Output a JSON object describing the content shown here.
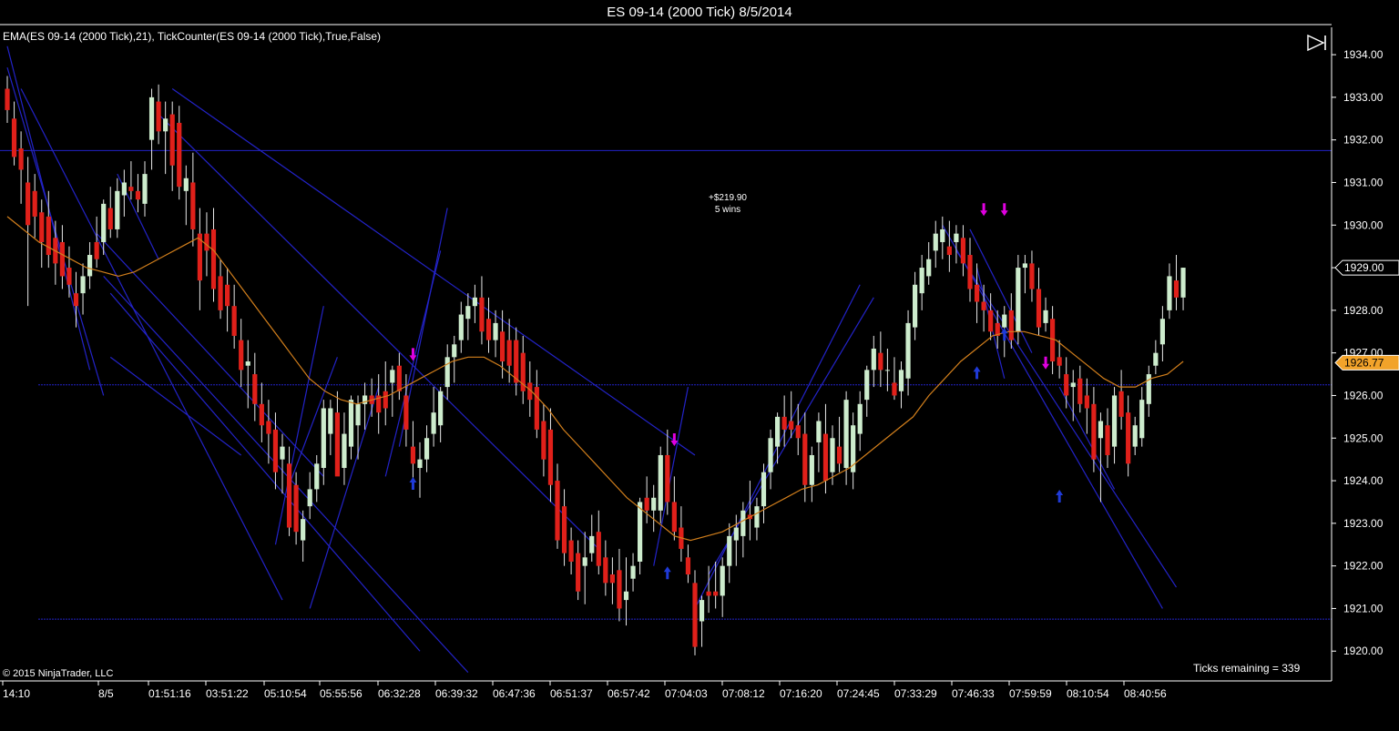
{
  "window": {
    "title": "ES 09-14 (2000 Tick)  8/5/2014"
  },
  "indicators_label": "EMA(ES 09-14 (2000 Tick),21),  TickCounter(ES 09-14 (2000 Tick),True,False)",
  "copyright": "© 2015 NinjaTrader, LLC",
  "ticks_remaining": "Ticks remaining = 339",
  "pnl": {
    "amount": "+$219.90",
    "wins": "5 wins"
  },
  "colors": {
    "background": "#000000",
    "up_candle": "#cdeccd",
    "down_candle": "#e0201a",
    "ema": "#d27f1c",
    "trendline": "#2323c8",
    "buy_arrow": "#1f3ad8",
    "sell_arrow": "#e000e0",
    "axis": "#ffffff",
    "last_price_fill": "#000000",
    "ema_price_fill": "#f2a32a"
  },
  "chart_data": {
    "type": "candlestick",
    "instrument": "ES 09-14",
    "bar_type": "2000 Tick",
    "ylim": [
      1919.3,
      1934.6
    ],
    "y_ticks": [
      "1934.00",
      "1933.00",
      "1932.00",
      "1931.00",
      "1930.00",
      "1929.00",
      "1928.00",
      "1927.00",
      "1926.00",
      "1925.00",
      "1924.00",
      "1923.00",
      "1922.00",
      "1921.00",
      "1920.00"
    ],
    "x_ticks": [
      "14:10",
      "8/5",
      "01:51:16",
      "03:51:22",
      "05:10:54",
      "05:55:56",
      "06:32:28",
      "06:39:32",
      "06:47:36",
      "06:51:37",
      "06:57:42",
      "07:04:03",
      "07:08:12",
      "07:16:20",
      "07:24:45",
      "07:33:29",
      "07:46:33",
      "07:59:59",
      "08:10:54",
      "08:40:56"
    ],
    "last_price_label": "1929.00",
    "ema_price_label": "1926.77",
    "horizontal_lines": [
      1931.75,
      1926.25,
      1920.75
    ],
    "candles": [
      [
        1933.2,
        1933.5,
        1932.4,
        1932.7
      ],
      [
        1932.5,
        1932.9,
        1931.4,
        1931.6
      ],
      [
        1931.8,
        1932.2,
        1930.5,
        1931.3
      ],
      [
        1931.0,
        1931.6,
        1928.1,
        1930.0
      ],
      [
        1930.8,
        1931.2,
        1929.7,
        1930.2
      ],
      [
        1930.3,
        1930.6,
        1929.0,
        1929.6
      ],
      [
        1930.2,
        1930.8,
        1929.0,
        1929.3
      ],
      [
        1929.7,
        1930.1,
        1928.6,
        1929.1
      ],
      [
        1929.6,
        1930.0,
        1928.5,
        1928.8
      ],
      [
        1929.0,
        1929.5,
        1928.3,
        1928.6
      ],
      [
        1928.4,
        1928.9,
        1927.6,
        1928.1
      ],
      [
        1928.4,
        1929.1,
        1927.9,
        1928.8
      ],
      [
        1928.8,
        1929.6,
        1928.5,
        1929.3
      ],
      [
        1929.6,
        1930.2,
        1929.0,
        1929.2
      ],
      [
        1929.6,
        1930.6,
        1929.3,
        1930.5
      ],
      [
        1930.4,
        1930.9,
        1929.7,
        1929.9
      ],
      [
        1929.9,
        1931.1,
        1929.7,
        1930.8
      ],
      [
        1930.7,
        1931.3,
        1930.2,
        1931.0
      ],
      [
        1930.9,
        1931.5,
        1930.6,
        1930.8
      ],
      [
        1930.8,
        1931.2,
        1930.3,
        1930.6
      ],
      [
        1930.5,
        1931.5,
        1930.2,
        1931.2
      ],
      [
        1932.0,
        1933.2,
        1931.3,
        1933.0
      ],
      [
        1932.9,
        1933.3,
        1931.9,
        1932.2
      ],
      [
        1932.2,
        1932.9,
        1931.2,
        1932.5
      ],
      [
        1932.6,
        1932.9,
        1930.8,
        1931.4
      ],
      [
        1932.4,
        1932.8,
        1930.6,
        1930.9
      ],
      [
        1930.8,
        1931.4,
        1930.0,
        1931.1
      ],
      [
        1931.0,
        1931.7,
        1929.5,
        1929.9
      ],
      [
        1929.8,
        1930.4,
        1928.0,
        1928.7
      ],
      [
        1929.8,
        1930.3,
        1928.8,
        1929.4
      ],
      [
        1929.9,
        1930.4,
        1928.2,
        1928.5
      ],
      [
        1928.8,
        1929.2,
        1927.8,
        1928.0
      ],
      [
        1928.6,
        1929.0,
        1927.5,
        1928.1
      ],
      [
        1928.1,
        1928.6,
        1927.1,
        1927.4
      ],
      [
        1927.3,
        1927.8,
        1926.2,
        1926.6
      ],
      [
        1926.7,
        1927.3,
        1925.7,
        1926.8
      ],
      [
        1926.5,
        1927.0,
        1925.4,
        1925.8
      ],
      [
        1925.8,
        1926.3,
        1924.9,
        1925.3
      ],
      [
        1925.4,
        1925.9,
        1924.4,
        1925.1
      ],
      [
        1925.2,
        1925.6,
        1923.8,
        1924.2
      ],
      [
        1924.5,
        1925.1,
        1923.7,
        1924.8
      ],
      [
        1924.4,
        1924.8,
        1922.7,
        1922.9
      ],
      [
        1923.9,
        1924.2,
        1922.5,
        1922.8
      ],
      [
        1922.6,
        1923.3,
        1922.1,
        1923.1
      ],
      [
        1923.4,
        1924.2,
        1923.1,
        1923.8
      ],
      [
        1923.8,
        1924.6,
        1923.5,
        1924.4
      ],
      [
        1924.3,
        1925.9,
        1923.9,
        1925.7
      ],
      [
        1925.1,
        1925.9,
        1924.6,
        1925.7
      ],
      [
        1925.6,
        1926.1,
        1924.7,
        1924.1
      ],
      [
        1924.3,
        1925.6,
        1923.9,
        1925.1
      ],
      [
        1924.8,
        1926.0,
        1924.5,
        1925.9
      ],
      [
        1925.3,
        1926.0,
        1924.5,
        1925.8
      ],
      [
        1925.8,
        1926.3,
        1925.2,
        1926.0
      ],
      [
        1926.0,
        1926.4,
        1925.5,
        1925.8
      ],
      [
        1926.0,
        1926.5,
        1925.1,
        1925.6
      ],
      [
        1926.1,
        1926.8,
        1925.3,
        1925.7
      ],
      [
        1926.3,
        1926.7,
        1925.5,
        1926.6
      ],
      [
        1926.7,
        1927.0,
        1925.9,
        1926.1
      ],
      [
        1926.0,
        1926.5,
        1924.8,
        1925.2
      ],
      [
        1924.8,
        1925.4,
        1924.0,
        1924.4
      ],
      [
        1924.3,
        1924.9,
        1923.6,
        1924.5
      ],
      [
        1924.5,
        1925.3,
        1924.2,
        1925.0
      ],
      [
        1925.1,
        1926.2,
        1924.8,
        1925.6
      ],
      [
        1925.3,
        1926.2,
        1924.9,
        1926.1
      ],
      [
        1926.2,
        1927.2,
        1925.9,
        1926.9
      ],
      [
        1926.9,
        1927.4,
        1926.3,
        1927.2
      ],
      [
        1927.3,
        1928.2,
        1927.0,
        1927.9
      ],
      [
        1927.8,
        1928.4,
        1927.3,
        1928.1
      ],
      [
        1928.1,
        1928.6,
        1927.7,
        1928.3
      ],
      [
        1928.3,
        1928.8,
        1927.2,
        1927.5
      ],
      [
        1927.8,
        1928.3,
        1927.0,
        1927.3
      ],
      [
        1927.3,
        1928.0,
        1926.9,
        1927.7
      ],
      [
        1927.5,
        1928.0,
        1926.4,
        1926.8
      ],
      [
        1927.3,
        1927.8,
        1926.3,
        1926.7
      ],
      [
        1927.3,
        1927.6,
        1926.0,
        1926.3
      ],
      [
        1927.0,
        1927.4,
        1925.8,
        1926.1
      ],
      [
        1926.3,
        1926.8,
        1925.5,
        1925.9
      ],
      [
        1926.2,
        1926.6,
        1925.0,
        1925.2
      ],
      [
        1925.4,
        1925.8,
        1924.1,
        1924.5
      ],
      [
        1925.2,
        1925.7,
        1923.5,
        1923.9
      ],
      [
        1924.0,
        1924.4,
        1922.4,
        1922.6
      ],
      [
        1923.4,
        1923.8,
        1922.0,
        1922.3
      ],
      [
        1922.6,
        1922.9,
        1921.8,
        1922.1
      ],
      [
        1922.3,
        1922.6,
        1921.2,
        1921.4
      ],
      [
        1922.0,
        1922.8,
        1921.1,
        1922.2
      ],
      [
        1922.3,
        1923.2,
        1922.1,
        1922.7
      ],
      [
        1922.8,
        1923.3,
        1921.8,
        1922.0
      ],
      [
        1922.2,
        1922.6,
        1921.3,
        1921.6
      ],
      [
        1921.8,
        1922.2,
        1921.1,
        1921.6
      ],
      [
        1921.9,
        1922.4,
        1920.7,
        1921.0
      ],
      [
        1921.2,
        1922.2,
        1920.6,
        1921.4
      ],
      [
        1921.7,
        1922.3,
        1921.4,
        1922.0
      ],
      [
        1922.1,
        1923.6,
        1921.8,
        1923.5
      ],
      [
        1923.6,
        1924.1,
        1923.0,
        1923.3
      ],
      [
        1923.3,
        1923.9,
        1922.8,
        1923.6
      ],
      [
        1923.3,
        1924.8,
        1923.0,
        1924.6
      ],
      [
        1924.6,
        1925.2,
        1923.2,
        1923.5
      ],
      [
        1923.5,
        1924.1,
        1922.6,
        1922.8
      ],
      [
        1922.9,
        1923.4,
        1922.1,
        1922.4
      ],
      [
        1922.2,
        1922.5,
        1921.6,
        1921.8
      ],
      [
        1921.6,
        1921.9,
        1919.9,
        1920.1
      ],
      [
        1920.7,
        1921.3,
        1920.1,
        1921.2
      ],
      [
        1921.4,
        1922.0,
        1920.9,
        1921.3
      ],
      [
        1921.4,
        1922.1,
        1921.0,
        1921.3
      ],
      [
        1921.3,
        1922.2,
        1920.8,
        1922.0
      ],
      [
        1922.0,
        1923.0,
        1921.6,
        1922.7
      ],
      [
        1922.6,
        1923.2,
        1922.0,
        1922.9
      ],
      [
        1922.7,
        1923.5,
        1922.2,
        1923.3
      ],
      [
        1923.2,
        1924.0,
        1922.6,
        1923.1
      ],
      [
        1922.9,
        1923.6,
        1922.6,
        1923.4
      ],
      [
        1923.4,
        1924.4,
        1923.0,
        1924.2
      ],
      [
        1924.2,
        1925.2,
        1923.8,
        1925.0
      ],
      [
        1924.8,
        1925.6,
        1924.4,
        1925.5
      ],
      [
        1925.5,
        1926.0,
        1924.8,
        1925.2
      ],
      [
        1925.4,
        1926.1,
        1925.0,
        1925.2
      ],
      [
        1925.3,
        1925.8,
        1924.6,
        1925.0
      ],
      [
        1925.1,
        1925.6,
        1923.5,
        1923.9
      ],
      [
        1923.9,
        1924.8,
        1923.5,
        1924.6
      ],
      [
        1924.9,
        1925.6,
        1924.2,
        1925.4
      ],
      [
        1925.1,
        1925.8,
        1923.7,
        1924.0
      ],
      [
        1924.2,
        1925.3,
        1923.9,
        1925.0
      ],
      [
        1924.8,
        1925.5,
        1924.2,
        1924.4
      ],
      [
        1924.3,
        1926.1,
        1923.9,
        1925.9
      ],
      [
        1924.2,
        1925.6,
        1923.8,
        1925.3
      ],
      [
        1925.1,
        1926.1,
        1924.7,
        1925.8
      ],
      [
        1925.9,
        1926.7,
        1925.5,
        1926.6
      ],
      [
        1926.6,
        1927.4,
        1926.2,
        1927.1
      ],
      [
        1927.0,
        1927.5,
        1926.2,
        1926.6
      ],
      [
        1926.6,
        1927.1,
        1926.1,
        1926.6
      ],
      [
        1926.3,
        1926.9,
        1925.9,
        1926.0
      ],
      [
        1926.1,
        1926.8,
        1925.7,
        1926.6
      ],
      [
        1926.4,
        1928.0,
        1926.0,
        1927.7
      ],
      [
        1927.6,
        1928.9,
        1927.3,
        1928.6
      ],
      [
        1928.4,
        1929.3,
        1928.0,
        1929.0
      ],
      [
        1928.8,
        1929.6,
        1928.6,
        1929.2
      ],
      [
        1929.4,
        1930.1,
        1929.0,
        1929.8
      ],
      [
        1929.6,
        1930.2,
        1929.2,
        1929.9
      ],
      [
        1929.5,
        1930.1,
        1928.9,
        1929.3
      ],
      [
        1929.6,
        1930.0,
        1929.1,
        1929.8
      ],
      [
        1929.7,
        1930.0,
        1928.8,
        1929.1
      ],
      [
        1929.3,
        1929.7,
        1928.2,
        1928.5
      ],
      [
        1928.6,
        1929.1,
        1927.7,
        1928.2
      ],
      [
        1928.2,
        1928.6,
        1927.5,
        1928.0
      ],
      [
        1928.0,
        1928.4,
        1927.3,
        1927.5
      ],
      [
        1927.7,
        1928.0,
        1927.1,
        1927.4
      ],
      [
        1927.6,
        1928.1,
        1926.9,
        1927.9
      ],
      [
        1928.0,
        1928.4,
        1927.1,
        1927.3
      ],
      [
        1927.5,
        1929.3,
        1927.2,
        1929.0
      ],
      [
        1929.0,
        1929.3,
        1928.4,
        1929.1
      ],
      [
        1929.1,
        1929.4,
        1928.2,
        1928.5
      ],
      [
        1928.5,
        1929.0,
        1927.4,
        1927.6
      ],
      [
        1927.7,
        1928.3,
        1927.5,
        1928.0
      ],
      [
        1927.8,
        1928.1,
        1926.5,
        1926.8
      ],
      [
        1926.9,
        1927.3,
        1926.4,
        1926.7
      ],
      [
        1926.5,
        1926.9,
        1925.7,
        1926.0
      ],
      [
        1926.2,
        1926.6,
        1925.4,
        1926.3
      ],
      [
        1926.4,
        1926.7,
        1925.6,
        1925.8
      ],
      [
        1926.0,
        1926.4,
        1925.1,
        1925.7
      ],
      [
        1925.8,
        1926.2,
        1924.2,
        1924.5
      ],
      [
        1925.0,
        1925.6,
        1923.5,
        1925.4
      ],
      [
        1925.3,
        1925.7,
        1924.3,
        1924.6
      ],
      [
        1924.8,
        1926.2,
        1924.4,
        1926.0
      ],
      [
        1926.1,
        1926.6,
        1925.2,
        1925.5
      ],
      [
        1925.6,
        1926.0,
        1924.1,
        1924.4
      ],
      [
        1924.8,
        1925.5,
        1924.6,
        1925.3
      ],
      [
        1925.0,
        1926.2,
        1924.8,
        1925.9
      ],
      [
        1925.8,
        1926.7,
        1925.5,
        1926.5
      ],
      [
        1926.7,
        1927.3,
        1926.5,
        1927.0
      ],
      [
        1927.2,
        1928.1,
        1926.8,
        1927.8
      ],
      [
        1928.0,
        1929.1,
        1927.8,
        1928.8
      ],
      [
        1928.7,
        1929.3,
        1928.0,
        1928.3
      ],
      [
        1928.3,
        1929.0,
        1928.0,
        1929.0
      ]
    ],
    "ema_21": [
      1930.2,
      1929.9,
      1929.6,
      1929.4,
      1929.2,
      1929.0,
      1928.9,
      1928.8,
      1928.9,
      1929.1,
      1929.3,
      1929.5,
      1929.7,
      1929.4,
      1928.9,
      1928.4,
      1927.9,
      1927.4,
      1926.9,
      1926.4,
      1926.1,
      1925.9,
      1925.8,
      1925.9,
      1926.0,
      1926.2,
      1926.4,
      1926.6,
      1926.8,
      1926.9,
      1926.9,
      1926.7,
      1926.4,
      1926.1,
      1925.7,
      1925.2,
      1924.8,
      1924.4,
      1924.0,
      1923.6,
      1923.3,
      1923.0,
      1922.7,
      1922.6,
      1922.7,
      1922.8,
      1923.0,
      1923.2,
      1923.4,
      1923.6,
      1923.8,
      1923.9,
      1924.1,
      1924.3,
      1924.6,
      1924.9,
      1925.2,
      1925.5,
      1926.0,
      1926.4,
      1926.8,
      1927.1,
      1927.4,
      1927.5,
      1927.5,
      1927.4,
      1927.3,
      1927.0,
      1926.7,
      1926.4,
      1926.2,
      1926.2,
      1926.4,
      1926.5,
      1926.8
    ],
    "buy_signals": [
      [
        1924.3,
        "low"
      ],
      [
        1922.2,
        "low"
      ],
      [
        1926.9,
        "low"
      ],
      [
        1927.8,
        "low"
      ],
      [
        1924.0,
        "low"
      ]
    ],
    "sell_signals": [
      [
        1926.6,
        "high"
      ],
      [
        1924.6,
        "high"
      ],
      [
        1930.0,
        "high"
      ],
      [
        1930.0,
        "high"
      ],
      [
        1926.4,
        "high"
      ]
    ],
    "trendlines": [
      [
        1934.2,
        0,
        1926.6,
        12
      ],
      [
        1933.7,
        0,
        1926.0,
        14
      ],
      [
        1933.2,
        2,
        1921.2,
        40
      ],
      [
        1929.8,
        13,
        1924.1,
        46
      ],
      [
        1928.8,
        14,
        1919.5,
        67
      ],
      [
        1928.4,
        15,
        1920.0,
        60
      ],
      [
        1926.9,
        15,
        1924.6,
        34
      ],
      [
        1931.2,
        16,
        1929.2,
        22
      ],
      [
        1932.6,
        22,
        1922.4,
        86
      ],
      [
        1933.2,
        24,
        1924.6,
        100
      ],
      [
        1922.5,
        39,
        1928.1,
        46
      ],
      [
        1923.9,
        41,
        1926.9,
        48
      ],
      [
        1921.0,
        44,
        1926.2,
        54
      ],
      [
        1924.1,
        55,
        1929.4,
        63
      ],
      [
        1924.8,
        57,
        1930.4,
        64
      ],
      [
        1922.0,
        94,
        1926.2,
        99
      ],
      [
        1921.0,
        100,
        1928.6,
        124
      ],
      [
        1921.8,
        102,
        1928.3,
        126
      ],
      [
        1930.0,
        136,
        1921.0,
        168
      ],
      [
        1929.4,
        138,
        1921.5,
        170
      ],
      [
        1929.0,
        141,
        1926.4,
        145
      ],
      [
        1929.9,
        140,
        1927.0,
        149
      ],
      [
        1926.2,
        153,
        1923.8,
        161
      ]
    ]
  }
}
